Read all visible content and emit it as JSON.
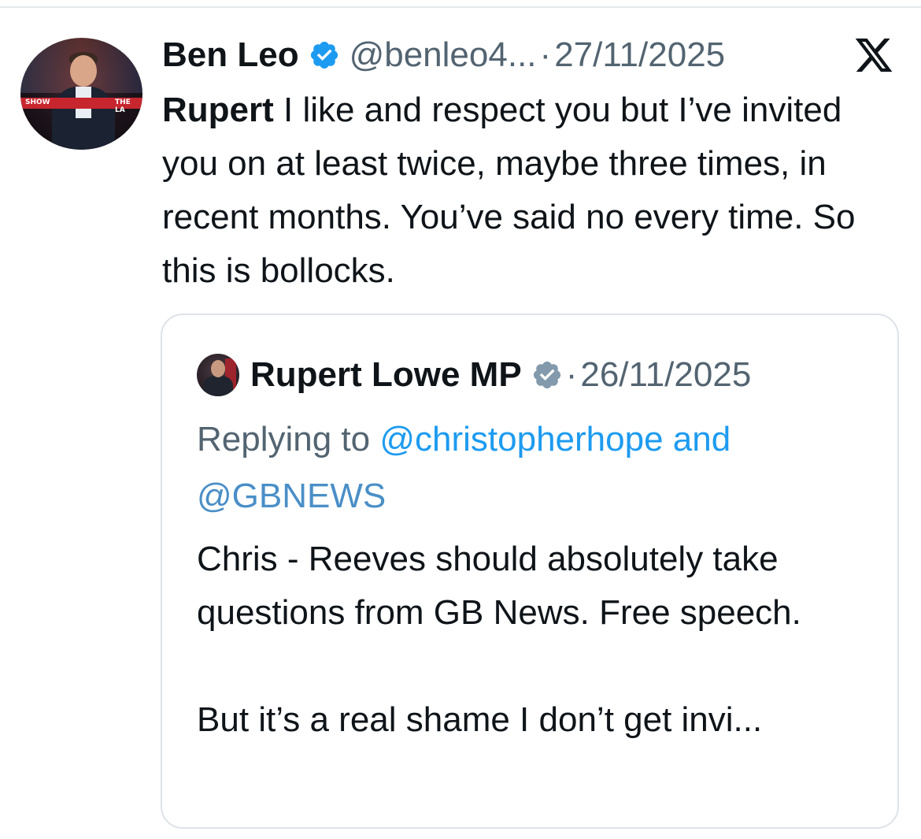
{
  "tweet": {
    "author_name": "Ben Leo",
    "author_handle": "@benleo4...",
    "separator": "·",
    "date": "27/11/2025",
    "avatar_band_left": "SHOW",
    "avatar_band_right": "THE LA",
    "body_mention": "Rupert",
    "body_text": " I like and respect you but I’ve invited you on at least twice, maybe three times, in recent months. You’ve said no every time. So this is bollocks."
  },
  "quote": {
    "author_name": "Rupert Lowe MP",
    "separator": "·",
    "date": "26/11/2025",
    "replying_prefix": "Replying to ",
    "replying_handle_1": "@christopherhope",
    "replying_and": " and",
    "replying_handle_2": "@GBNEWS",
    "body_line_1": "Chris - Reeves should absolutely take questions from GB News. Free speech.",
    "body_line_2": "But it’s a real shame I don’t get invi..."
  },
  "colors": {
    "text_primary": "#0f1419",
    "text_secondary": "#536471",
    "link": "#1d9bf0",
    "verified_blue": "#1d9bf0",
    "verified_grey": "#829aab",
    "card_border": "#dde3e8"
  },
  "icons": {
    "verified": "verified-badge-icon",
    "platform": "x-logo-icon"
  }
}
